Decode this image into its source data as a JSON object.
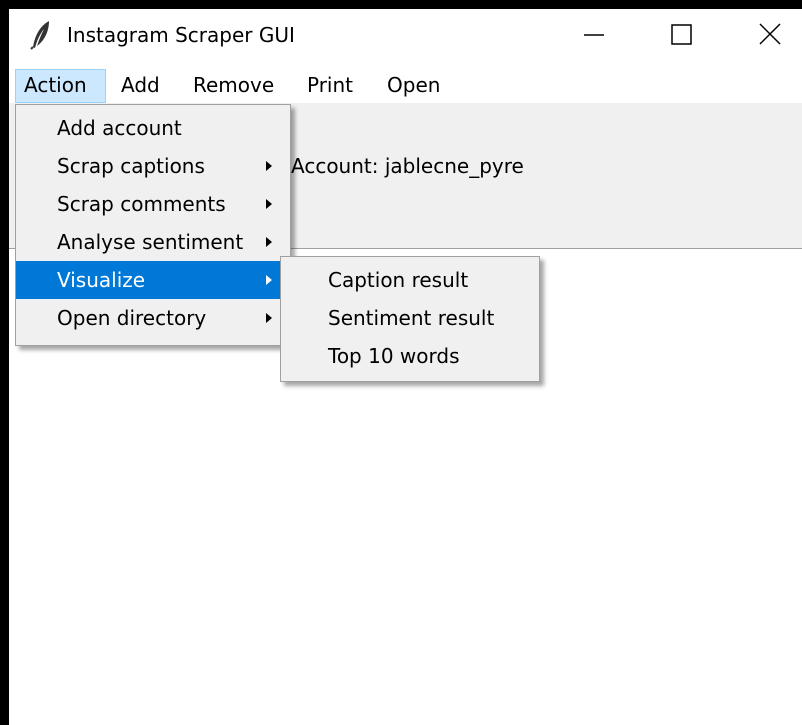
{
  "window": {
    "title": "Instagram Scraper GUI",
    "icon": "feather-icon",
    "controls": {
      "minimize_icon": "minimize-icon",
      "maximize_icon": "maximize-icon",
      "close_icon": "close-icon"
    }
  },
  "menubar": {
    "items": [
      {
        "label": "Action",
        "active": true
      },
      {
        "label": "Add"
      },
      {
        "label": "Remove"
      },
      {
        "label": "Print"
      },
      {
        "label": "Open"
      }
    ]
  },
  "panel": {
    "account_label": "Account: jablecne_pyre"
  },
  "action_menu": {
    "items": [
      {
        "label": "Add account",
        "has_submenu": false
      },
      {
        "label": "Scrap captions",
        "has_submenu": true
      },
      {
        "label": "Scrap comments",
        "has_submenu": true
      },
      {
        "label": "Analyse sentiment",
        "has_submenu": true
      },
      {
        "label": "Visualize",
        "has_submenu": true,
        "highlighted": true
      },
      {
        "label": "Open directory",
        "has_submenu": true
      }
    ]
  },
  "visualize_submenu": {
    "items": [
      {
        "label": "Caption result"
      },
      {
        "label": "Sentiment result"
      },
      {
        "label": "Top 10 words"
      }
    ]
  },
  "colors": {
    "highlight": "#0078d7",
    "active_menubar": "#cce8ff",
    "menu_background": "#f0f0f0"
  }
}
